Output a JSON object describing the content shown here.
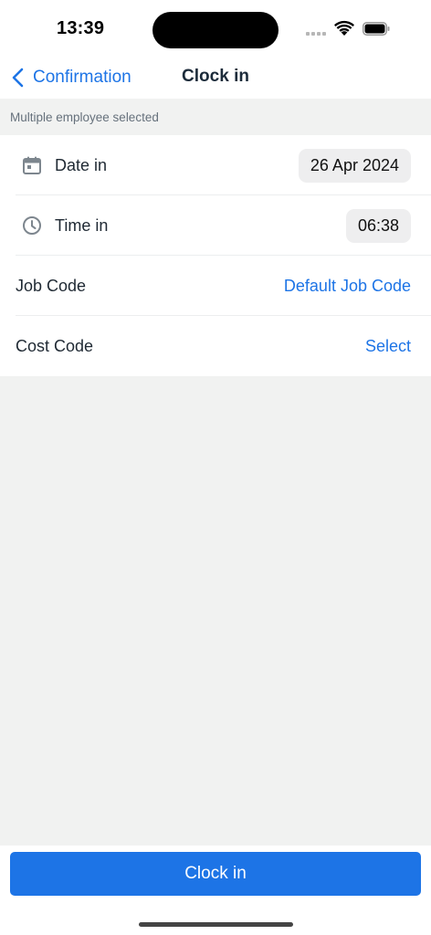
{
  "status_bar": {
    "time": "13:39"
  },
  "nav": {
    "back_label": "Confirmation",
    "title": "Clock in"
  },
  "section": {
    "header": "Multiple employee selected"
  },
  "form": {
    "date_in": {
      "label": "Date in",
      "value": "26 Apr 2024",
      "icon": "calendar-icon"
    },
    "time_in": {
      "label": "Time in",
      "value": "06:38",
      "icon": "clock-icon"
    },
    "job_code": {
      "label": "Job Code",
      "value": "Default Job Code"
    },
    "cost_code": {
      "label": "Cost Code",
      "value": "Select"
    }
  },
  "footer": {
    "primary_label": "Clock in"
  },
  "colors": {
    "accent": "#1d74e6",
    "background": "#f1f2f1",
    "pill": "#eeeeef",
    "icon": "#7d868e"
  }
}
